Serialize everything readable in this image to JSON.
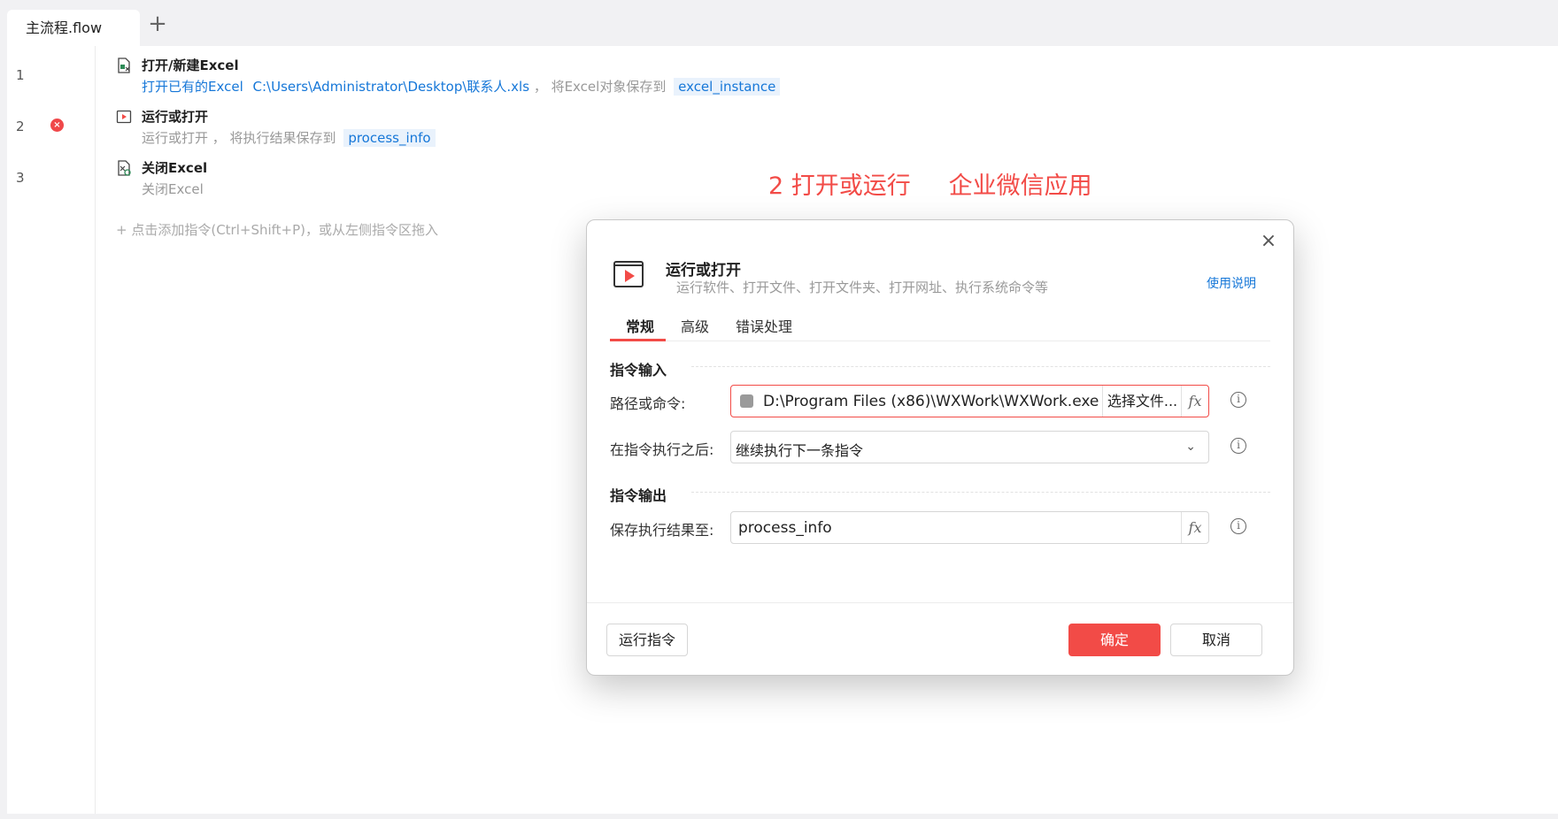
{
  "tabbar": {
    "tab_label": "主流程.flow",
    "add_symbol": "+"
  },
  "gutter": {
    "lines": [
      "1",
      "2",
      "3"
    ],
    "error_mark": "×"
  },
  "steps": [
    {
      "title": "打开/新建Excel",
      "desc_link": "打开已有的Excel",
      "desc_path": "C:\\Users\\Administrator\\Desktop\\联系人.xls",
      "desc_tail": "， 将Excel对象保存到",
      "var": "excel_instance"
    },
    {
      "title": "运行或打开",
      "desc_text": "运行或打开 ， 将执行结果保存到",
      "var": "process_info"
    },
    {
      "title": "关闭Excel",
      "desc_text": "关闭Excel"
    }
  ],
  "add_hint": "+ 点击添加指令(Ctrl+Shift+P)，或从左侧指令区拖入",
  "annotation": "2 打开或运行     企业微信应用",
  "dialog": {
    "close_symbol": "×",
    "title": "运行或打开",
    "subtitle": "运行软件、打开文件、打开文件夹、打开网址、执行系统命令等",
    "help_link": "使用说明",
    "tabs": [
      "常规",
      "高级",
      "错误处理"
    ],
    "section_input": "指令输入",
    "path_label": "路径或命令:",
    "path_value": "D:\\Program Files (x86)\\WXWork\\WXWork.exe",
    "choose_file": "选择文件...",
    "fx": "fx",
    "after_label": "在指令执行之后:",
    "after_value": "继续执行下一条指令",
    "section_output": "指令输出",
    "save_label": "保存执行结果至:",
    "save_value": "process_info",
    "info_symbol": "i",
    "run_button": "运行指令",
    "ok_button": "确定",
    "cancel_button": "取消"
  },
  "colors": {
    "accent": "#f24b47",
    "link": "#1677d8",
    "var_bg": "#e9f2fc"
  }
}
